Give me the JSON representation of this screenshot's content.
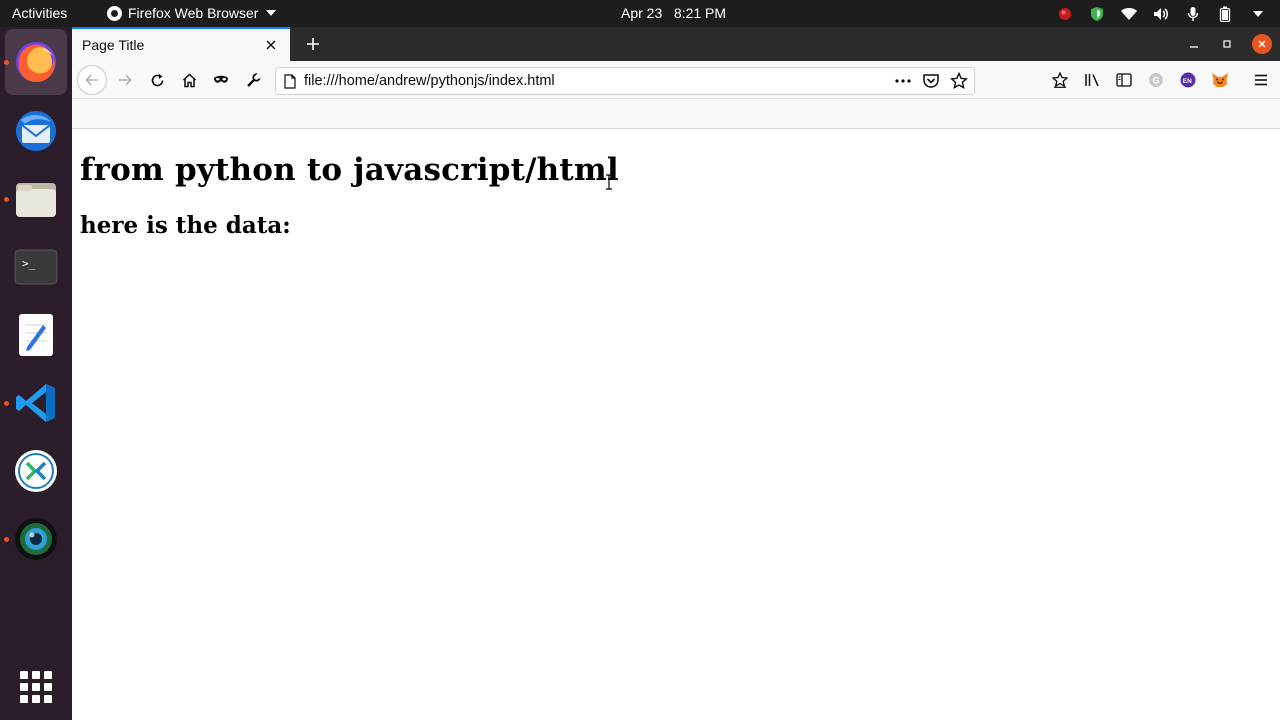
{
  "topbar": {
    "activities_label": "Activities",
    "app_name": "Firefox Web Browser",
    "clock": "Apr 23   8:21 PM"
  },
  "dock": {
    "items": [
      {
        "icon": "firefox-icon",
        "active": true,
        "running": true
      },
      {
        "icon": "thunderbird-icon",
        "running": false
      },
      {
        "icon": "files-icon",
        "running": true
      },
      {
        "icon": "terminal-icon",
        "running": false
      },
      {
        "icon": "text-editor-icon",
        "running": false
      },
      {
        "icon": "vscode-icon",
        "running": true
      },
      {
        "icon": "remote-desktop-icon",
        "running": false
      },
      {
        "icon": "webcam-icon",
        "running": true
      }
    ],
    "show_apps_icon": "apps-grid-icon"
  },
  "browser": {
    "tab_title": "Page Title",
    "url": "file:///home/andrew/pythonjs/index.html"
  },
  "page": {
    "heading": "from python to javascript/html",
    "subheading": "here is the data:"
  },
  "colors": {
    "topbar_bg": "#1d1d1d",
    "dock_bg": "#2b1d2a",
    "accent": "#e95420",
    "tab_highlight": "#0a84ff"
  }
}
